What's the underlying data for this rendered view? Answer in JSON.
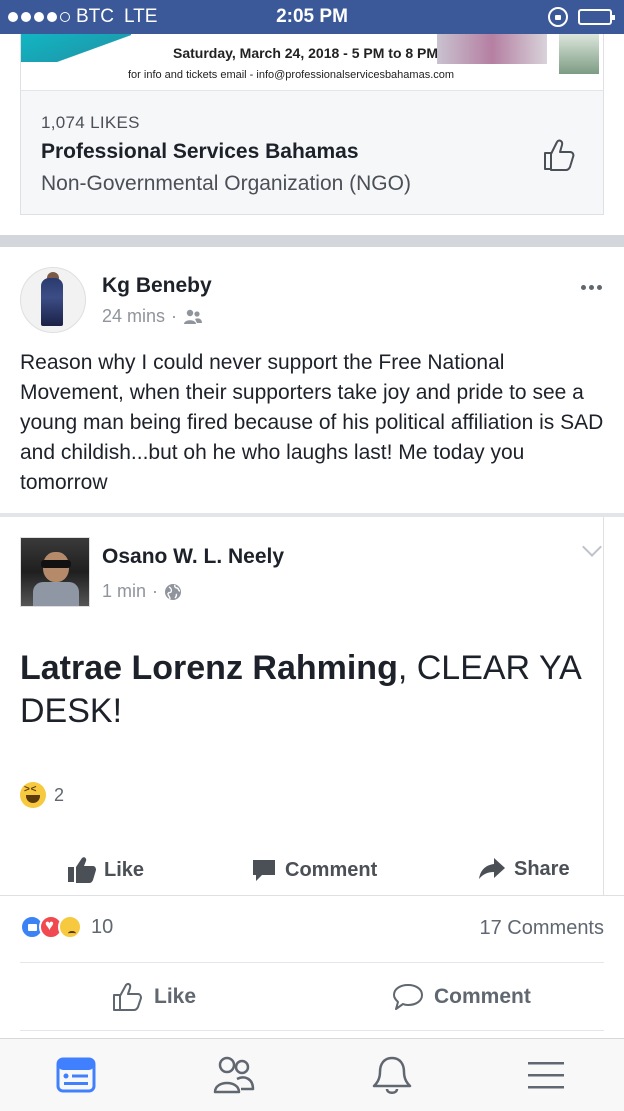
{
  "status_bar": {
    "carrier": "BTC",
    "network": "LTE",
    "time": "2:05 PM"
  },
  "page_card": {
    "banner_date": "Saturday, March 24, 2018 - 5 PM to 8 PM",
    "banner_info": "for info and tickets email - info@professionalservicesbahamas.com",
    "likes_count": "1,074 LIKES",
    "page_name": "Professional Services Bahamas",
    "page_category": "Non-Governmental Organization (NGO)"
  },
  "post": {
    "author": "Kg Beneby",
    "time": "24 mins",
    "meta_sep": "·",
    "audience_icon": "friends-icon",
    "text": "Reason why I could never support the Free National Movement, when their supporters take joy and pride to see a young man being fired because of his political affiliation is SAD and childish...but oh he who laughs last! Me today you tomorrow"
  },
  "shared_post": {
    "author": "Osano W. L. Neely",
    "time": "1 min",
    "meta_sep": "·",
    "audience_icon": "globe-icon",
    "text_bold": "Latrae Lorenz Rahming",
    "text_rest": ", CLEAR YA DESK!",
    "reaction_count": "2",
    "actions": {
      "like": "Like",
      "comment": "Comment",
      "share": "Share"
    }
  },
  "outer_footer": {
    "reaction_count": "10",
    "comments_count": "17 Comments",
    "actions": {
      "like": "Like",
      "comment": "Comment"
    }
  },
  "colors": {
    "brand": "#3b5998",
    "tab_active": "#4080ff",
    "text_secondary": "#90949c"
  }
}
